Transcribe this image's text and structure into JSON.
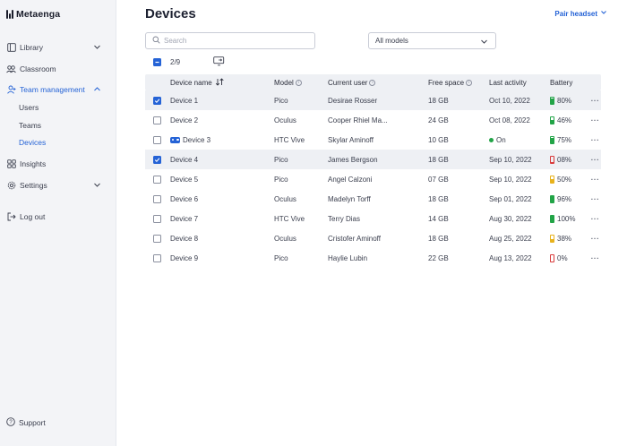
{
  "app": {
    "name": "Metaenga"
  },
  "sidebar": {
    "items": [
      {
        "label": "Library"
      },
      {
        "label": "Classroom"
      },
      {
        "label": "Team management"
      },
      {
        "label": "Insights"
      },
      {
        "label": "Settings"
      },
      {
        "label": "Log out"
      }
    ],
    "subitems": [
      {
        "label": "Users"
      },
      {
        "label": "Teams"
      },
      {
        "label": "Devices"
      }
    ],
    "support": "Support"
  },
  "header": {
    "title": "Devices",
    "pair_button": "Pair headset"
  },
  "filters": {
    "search_placeholder": "Search",
    "model_selected": "All models"
  },
  "bulk": {
    "count": "2/9"
  },
  "table": {
    "headers": {
      "name": "Device name",
      "model": "Model",
      "user": "Current user",
      "free": "Free space",
      "activity": "Last activity",
      "battery": "Battery"
    },
    "rows": [
      {
        "checked": true,
        "name": "Device 1",
        "model": "Pico",
        "user": "Desirae Rosser",
        "free": "18 GB",
        "activity": "Oct 10, 2022",
        "battery": "80%",
        "battery_level": 0.8,
        "battery_color": "#22a447"
      },
      {
        "checked": false,
        "name": "Device 2",
        "model": "Oculus",
        "user": "Cooper Rhiel Ma...",
        "free": "24 GB",
        "activity": "Oct 08, 2022",
        "battery": "46%",
        "battery_level": 0.46,
        "battery_color": "#22a447"
      },
      {
        "checked": false,
        "name": "Device 3",
        "model": "HTC Vive",
        "user": "Skylar Aminoff",
        "free": "10 GB",
        "activity": "On",
        "battery": "75%",
        "battery_level": 0.75,
        "battery_color": "#22a447"
      },
      {
        "checked": true,
        "name": "Device 4",
        "model": "Pico",
        "user": "James Bergson",
        "free": "18 GB",
        "activity": "Sep 10, 2022",
        "battery": "08%",
        "battery_level": 0.08,
        "battery_color": "#d93b3b"
      },
      {
        "checked": false,
        "name": "Device 5",
        "model": "Pico",
        "user": "Angel Calzoni",
        "free": "07 GB",
        "activity": "Sep 10, 2022",
        "battery": "50%",
        "battery_level": 0.5,
        "battery_color": "#e8b21c"
      },
      {
        "checked": false,
        "name": "Device 6",
        "model": "Oculus",
        "user": "Madelyn Torff",
        "free": "18 GB",
        "activity": "Sep 01, 2022",
        "battery": "96%",
        "battery_level": 0.96,
        "battery_color": "#22a447"
      },
      {
        "checked": false,
        "name": "Device 7",
        "model": "HTC Vive",
        "user": "Terry Dias",
        "free": "14 GB",
        "activity": "Aug 30, 2022",
        "battery": "100%",
        "battery_level": 1.0,
        "battery_color": "#22a447"
      },
      {
        "checked": false,
        "name": "Device 8",
        "model": "Oculus",
        "user": "Cristofer Aminoff",
        "free": "18 GB",
        "activity": "Aug 25, 2022",
        "battery": "38%",
        "battery_level": 0.38,
        "battery_color": "#e8b21c"
      },
      {
        "checked": false,
        "name": "Device 9",
        "model": "Pico",
        "user": "Haylie Lubin",
        "free": "22 GB",
        "activity": "Aug 13, 2022",
        "battery": "0%",
        "battery_level": 0.0,
        "battery_color": "#d93b3b"
      }
    ]
  },
  "colors": {
    "accent": "#2563d6",
    "online": "#22a447"
  }
}
